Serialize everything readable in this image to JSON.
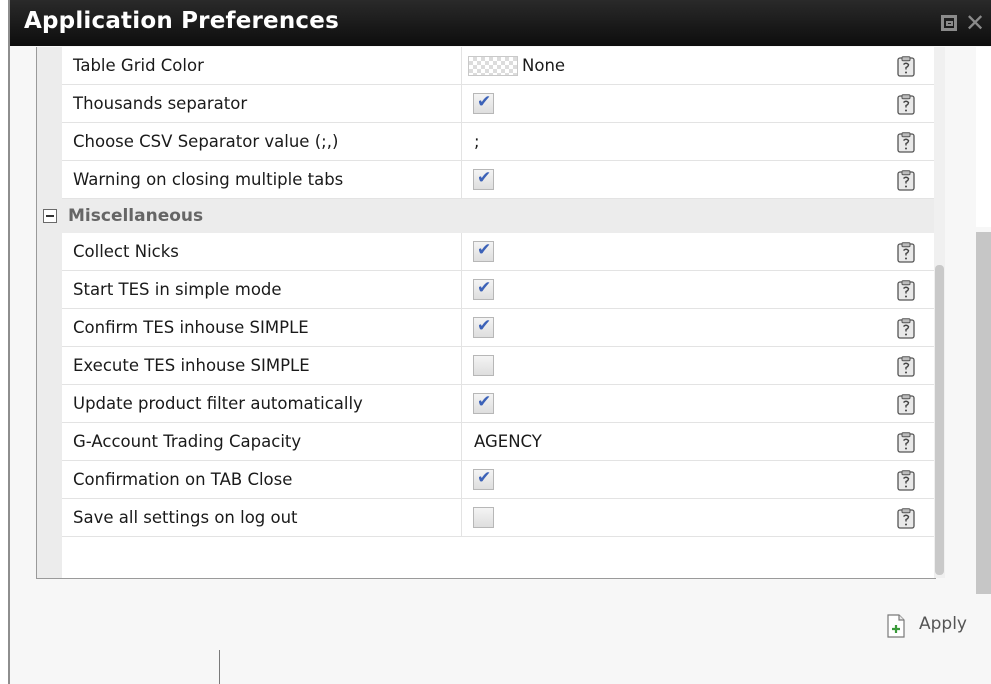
{
  "window": {
    "title": "Application Preferences",
    "restore_icon": "restore-icon",
    "close_icon": "close-icon"
  },
  "grid": {
    "top_rows": [
      {
        "name": "Table Grid Color",
        "type": "color",
        "value": "None",
        "help_icon": "clipboard-icon"
      },
      {
        "name": "Thousands separator",
        "type": "checkbox",
        "checked": true,
        "help_icon": "clipboard-icon"
      },
      {
        "name": "Choose CSV Separator value (;,)",
        "type": "text",
        "value": ";",
        "help_icon": "clipboard-icon"
      },
      {
        "name": "Warning on closing multiple tabs",
        "type": "checkbox",
        "checked": true,
        "help_icon": "clipboard-icon"
      }
    ],
    "category": {
      "label": "Miscellaneous",
      "expanded": true
    },
    "misc_rows": [
      {
        "name": "Collect Nicks",
        "type": "checkbox",
        "checked": true,
        "help_icon": "clipboard-icon"
      },
      {
        "name": "Start TES in simple mode",
        "type": "checkbox",
        "checked": true,
        "help_icon": "clipboard-icon"
      },
      {
        "name": "Confirm TES inhouse SIMPLE",
        "type": "checkbox",
        "checked": true,
        "help_icon": "clipboard-icon"
      },
      {
        "name": "Execute TES inhouse SIMPLE",
        "type": "checkbox",
        "checked": false,
        "help_icon": "clipboard-icon"
      },
      {
        "name": "Update product filter automatically",
        "type": "checkbox",
        "checked": true,
        "help_icon": "clipboard-icon"
      },
      {
        "name": "G-Account Trading Capacity",
        "type": "text",
        "value": "AGENCY",
        "help_icon": "clipboard-icon"
      },
      {
        "name": "Confirmation on TAB Close",
        "type": "checkbox",
        "checked": true,
        "help_icon": "clipboard-icon"
      },
      {
        "name": "Save all settings on log out",
        "type": "checkbox",
        "checked": false,
        "help_icon": "clipboard-icon"
      }
    ]
  },
  "footer": {
    "apply_label": "Apply",
    "apply_icon": "apply-document-icon"
  },
  "colors": {
    "titlebar": "#111111",
    "check_mark": "#3c62b8",
    "category_bg": "#ececec",
    "category_text": "#666666"
  }
}
